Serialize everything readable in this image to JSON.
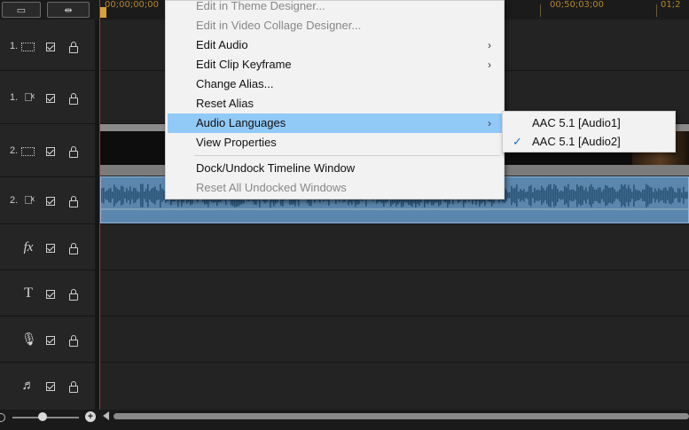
{
  "ruler": {
    "timecodes": [
      "00;00;00;00",
      "00;50;03;00",
      "01;2"
    ]
  },
  "tracks": [
    {
      "number": "1.",
      "type": "video-icon"
    },
    {
      "number": "1.",
      "type": "speaker-icon"
    },
    {
      "number": "2.",
      "type": "video-icon"
    },
    {
      "number": "2.",
      "type": "speaker-icon"
    },
    {
      "number": "",
      "type": "fx-icon",
      "glyph": "fx"
    },
    {
      "number": "",
      "type": "title-icon",
      "glyph": "T"
    },
    {
      "number": "",
      "type": "microphone-icon",
      "glyph": "🎙"
    },
    {
      "number": "",
      "type": "music-icon",
      "glyph": "♬"
    }
  ],
  "context_menu": {
    "items": [
      {
        "label": "Edit in Theme Designer...",
        "disabled": true
      },
      {
        "label": "Edit in Video Collage Designer...",
        "disabled": true
      },
      {
        "label": "Edit Audio",
        "submenu": true
      },
      {
        "label": "Edit Clip Keyframe",
        "submenu": true
      },
      {
        "label": "Change Alias..."
      },
      {
        "label": "Reset Alias"
      },
      {
        "label": "Audio Languages",
        "submenu": true,
        "highlighted": true
      },
      {
        "label": "View Properties"
      },
      {
        "label": "Dock/Undock Timeline Window"
      },
      {
        "label": "Reset All Undocked Windows",
        "disabled": true
      }
    ]
  },
  "submenu": {
    "items": [
      {
        "label": "AAC 5.1 [Audio1]",
        "checked": false
      },
      {
        "label": "AAC 5.1 [Audio2]",
        "checked": true
      }
    ]
  },
  "colors": {
    "accent_highlight": "#91c9f7",
    "playhead": "#cc2222",
    "audio_clip": "#5b86ad"
  }
}
